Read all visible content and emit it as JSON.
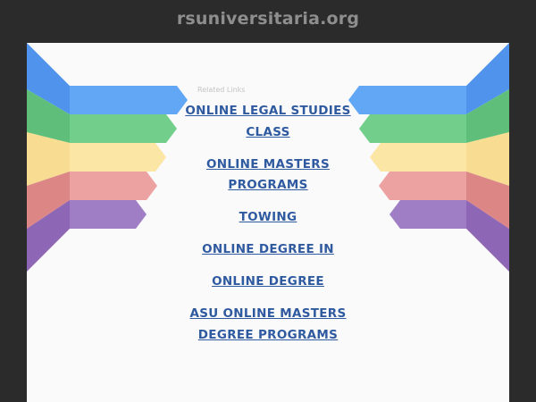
{
  "window": {
    "domain_title": "rsuniversitaria.org"
  },
  "related_heading": "Related Links",
  "links": [
    "ONLINE LEGAL STUDIES CLASS",
    "ONLINE MASTERS PROGRAMS",
    "TOWING",
    "ONLINE DEGREE IN",
    "ONLINE DEGREE",
    "ASU ONLINE MASTERS DEGREE PROGRAMS"
  ],
  "colors": {
    "background": "#2b2b2b",
    "panel": "#fafafa",
    "link": "#2f5aa0",
    "ribbon_blue": "#62a6f6",
    "ribbon_green": "#71cf8b",
    "ribbon_yellow": "#fbe6a6",
    "ribbon_red": "#e89a9a",
    "ribbon_purple": "#9d76c2"
  }
}
